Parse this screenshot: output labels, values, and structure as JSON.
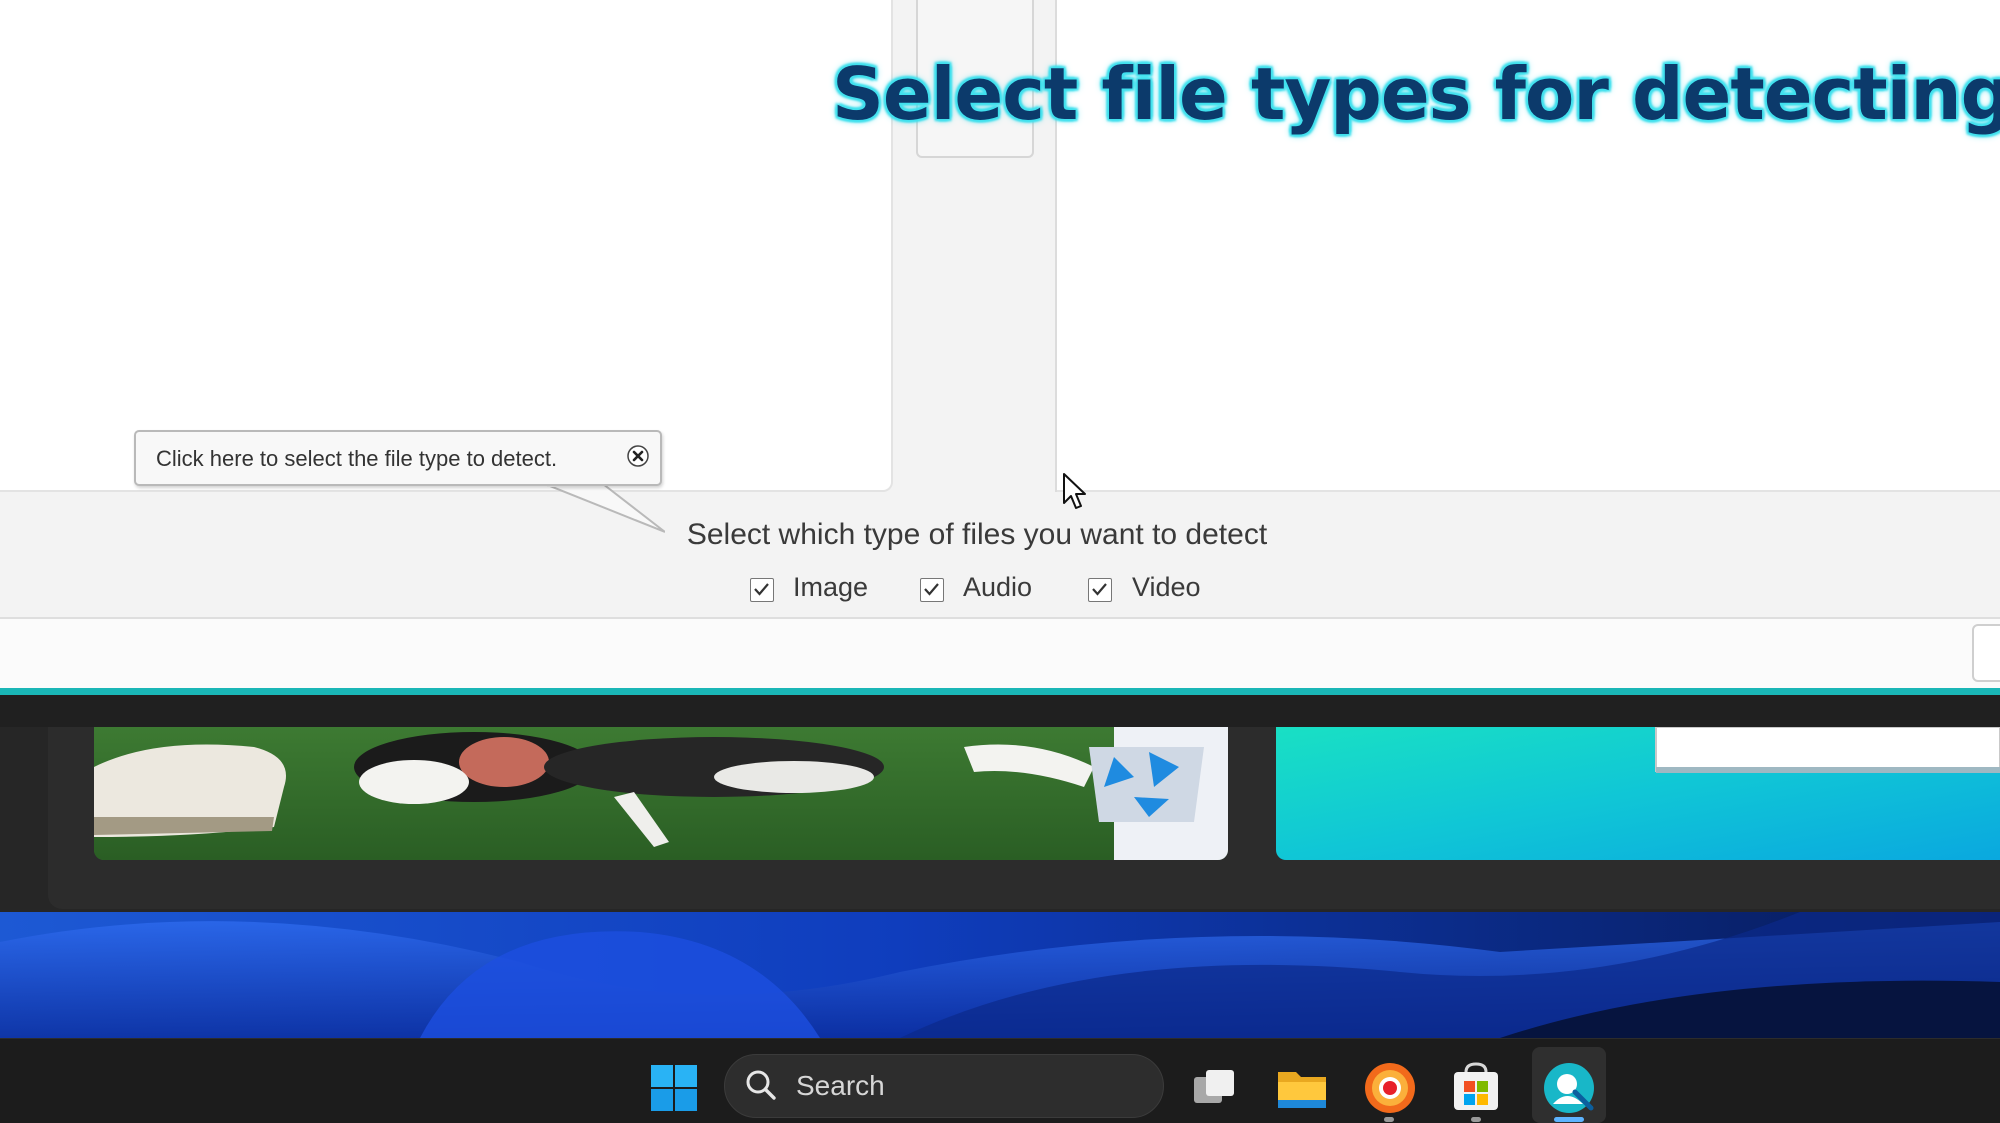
{
  "overlay": {
    "title": "Select file types for detecting"
  },
  "tooltip": {
    "text": "Click here to select the file type to detect."
  },
  "detection": {
    "prompt": "Select which type of files you want to detect",
    "options": [
      {
        "label": "Image",
        "checked": true
      },
      {
        "label": "Audio",
        "checked": true
      },
      {
        "label": "Video",
        "checked": true
      }
    ]
  },
  "taskbar": {
    "search_placeholder": "Search",
    "icons": [
      "windows-start-icon",
      "search-icon",
      "task-view-icon",
      "file-explorer-icon",
      "browser-icon",
      "microsoft-store-icon",
      "recovery-app-icon"
    ]
  },
  "colors": {
    "overlay_text": "#0c3a6b",
    "overlay_glow": "#41e1ee",
    "accent_line": "#1ab6b6",
    "taskbar": "#1c1c1c"
  }
}
